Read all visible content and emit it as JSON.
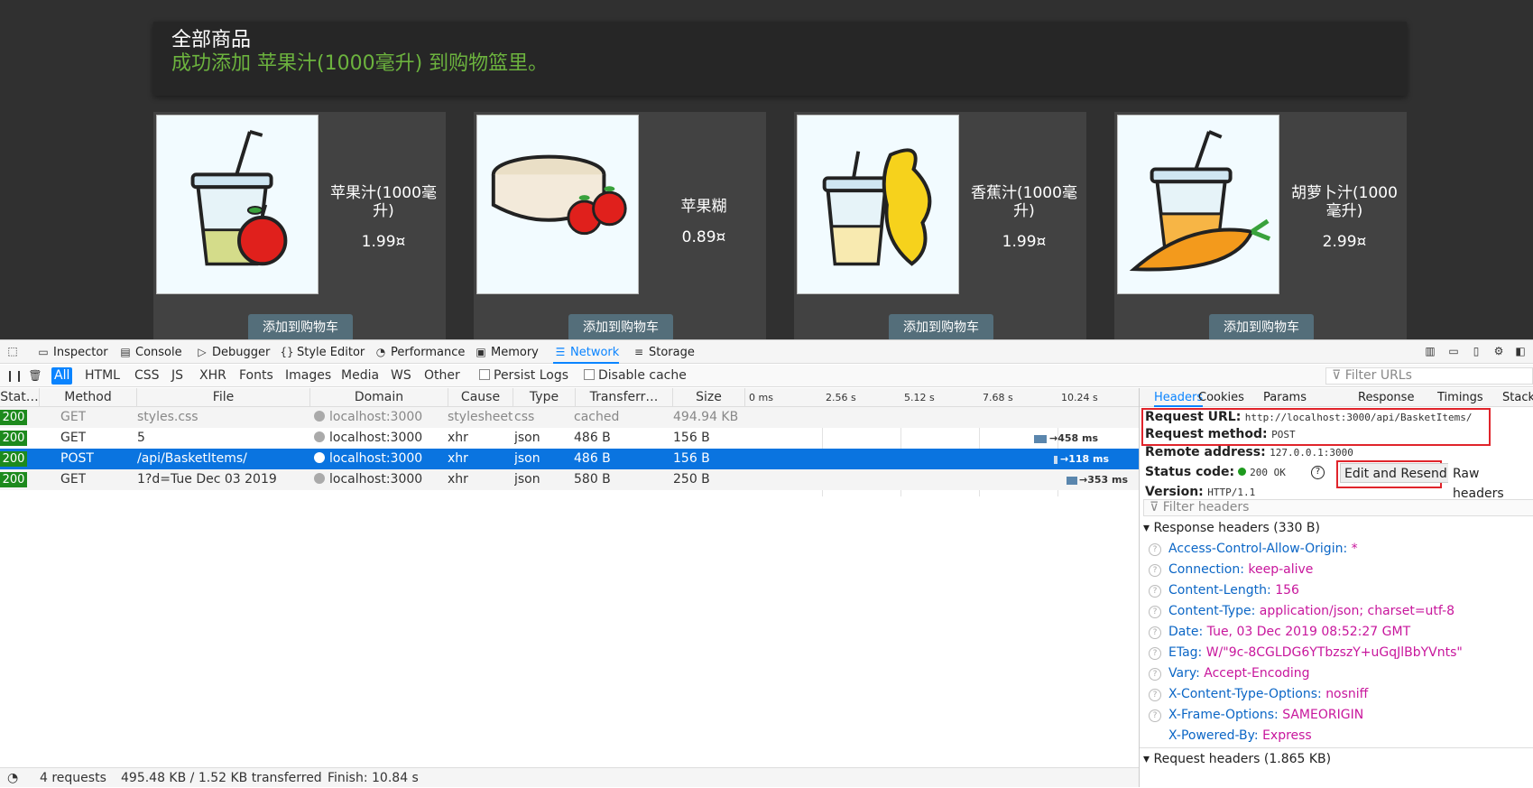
{
  "page": {
    "heading": "全部商品",
    "message": "成功添加 苹果汁(1000毫升) 到购物篮里。",
    "products": [
      {
        "name": "苹果汁(1000毫升)",
        "price": "1.99¤",
        "button": "添加到购物车"
      },
      {
        "name": "苹果糊",
        "price": "0.89¤",
        "button": "添加到购物车"
      },
      {
        "name": "香蕉汁(1000毫升)",
        "price": "1.99¤",
        "button": "添加到购物车"
      },
      {
        "name": "胡萝卜汁(1000毫升)",
        "price": "2.99¤",
        "button": "添加到购物车"
      }
    ]
  },
  "devtools": {
    "tabs": [
      {
        "label": "Inspector",
        "icon": "inspector-icon"
      },
      {
        "label": "Console",
        "icon": "console-icon"
      },
      {
        "label": "Debugger",
        "icon": "debugger-icon"
      },
      {
        "label": "Style Editor",
        "icon": "style-editor-icon"
      },
      {
        "label": "Performance",
        "icon": "performance-icon"
      },
      {
        "label": "Memory",
        "icon": "memory-icon"
      },
      {
        "label": "Network",
        "icon": "network-icon"
      },
      {
        "label": "Storage",
        "icon": "storage-icon"
      }
    ],
    "active_tab": "Network",
    "filter_types": [
      "All",
      "HTML",
      "CSS",
      "JS",
      "XHR",
      "Fonts",
      "Images",
      "Media",
      "WS",
      "Other"
    ],
    "persist_logs": "Persist Logs",
    "disable_cache": "Disable cache",
    "filter_urls_placeholder": "Filter URLs",
    "columns": [
      "Stat…",
      "Method",
      "File",
      "Domain",
      "Cause",
      "Type",
      "Transferr…",
      "Size"
    ],
    "timeline_ticks": [
      "0 ms",
      "2.56 s",
      "5.12 s",
      "7.68 s",
      "10.24 s"
    ],
    "requests": [
      {
        "status": "200",
        "method": "GET",
        "file": "styles.css",
        "domain": "localhost:3000",
        "cause": "stylesheet",
        "type": "css",
        "transferred": "cached",
        "size": "494.94 KB",
        "timing": ""
      },
      {
        "status": "200",
        "method": "GET",
        "file": "5",
        "domain": "localhost:3000",
        "cause": "xhr",
        "type": "json",
        "transferred": "486 B",
        "size": "156 B",
        "timing": "458 ms"
      },
      {
        "status": "200",
        "method": "POST",
        "file": "/api/BasketItems/",
        "domain": "localhost:3000",
        "cause": "xhr",
        "type": "json",
        "transferred": "486 B",
        "size": "156 B",
        "timing": "118 ms"
      },
      {
        "status": "200",
        "method": "GET",
        "file": "1?d=Tue Dec 03 2019",
        "domain": "localhost:3000",
        "cause": "xhr",
        "type": "json",
        "transferred": "580 B",
        "size": "250 B",
        "timing": "353 ms"
      }
    ],
    "statusbar": {
      "requests": "4 requests",
      "transferred": "495.48 KB / 1.52 KB transferred",
      "finish": "Finish: 10.84 s"
    },
    "side_tabs": [
      "Headers",
      "Cookies",
      "Params",
      "Response",
      "Timings",
      "Stack"
    ],
    "details": {
      "request_url_label": "Request URL:",
      "request_url": "http://localhost:3000/api/BasketItems/",
      "request_method_label": "Request method:",
      "request_method": "POST",
      "remote_address_label": "Remote address:",
      "remote_address": "127.0.0.1:3000",
      "status_code_label": "Status code:",
      "status_code": "200 OK",
      "version_label": "Version:",
      "version": "HTTP/1.1",
      "edit_resend": "Edit and Resend",
      "raw_headers": "Raw headers",
      "filter_headers_placeholder": "Filter headers",
      "response_headers_title": "Response headers (330 B)",
      "request_headers_title": "Request headers (1.865 KB)",
      "response_headers": [
        {
          "name": "Access-Control-Allow-Origin:",
          "value": "*"
        },
        {
          "name": "Connection:",
          "value": "keep-alive"
        },
        {
          "name": "Content-Length:",
          "value": "156"
        },
        {
          "name": "Content-Type:",
          "value": "application/json; charset=utf-8"
        },
        {
          "name": "Date:",
          "value": "Tue, 03 Dec 2019 08:52:27 GMT"
        },
        {
          "name": "ETag:",
          "value": "W/\"9c-8CGLDG6YTbzszY+uGqJlBbYVnts\""
        },
        {
          "name": "Vary:",
          "value": "Accept-Encoding"
        },
        {
          "name": "X-Content-Type-Options:",
          "value": "nosniff"
        },
        {
          "name": "X-Frame-Options:",
          "value": "SAMEORIGIN"
        },
        {
          "name": "X-Powered-By:",
          "value": "Express"
        }
      ]
    }
  },
  "colors": {
    "accent": "#0a84ff",
    "success": "#6cb33e",
    "selected_row": "#0a74e0",
    "status_ok": "#1d8a1d",
    "highlight_box": "#e0242b"
  }
}
